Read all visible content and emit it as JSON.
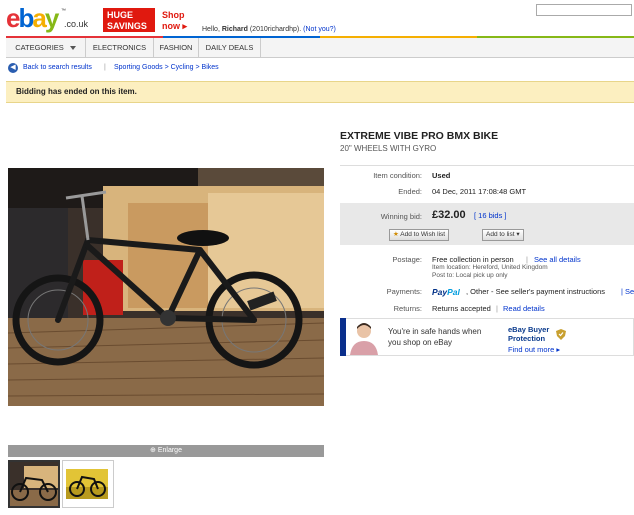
{
  "header": {
    "logo_text": "ebay.co.uk",
    "promo_badge": [
      "HUGE",
      "SAVINGS"
    ],
    "shop_now": [
      "Shop",
      "now ▸"
    ],
    "greeting_prefix": "Hello, ",
    "user_name": "Richard",
    "user_handle": " (2010richardhp).",
    "not_you": "(Not you?)"
  },
  "nav": {
    "categories": "CATEGORIES",
    "electronics": "ELECTRONICS",
    "fashion": "FASHION",
    "daily_deals": "DAILY DEALS"
  },
  "breadcrumb": {
    "back": "Back to search results",
    "sep": "|",
    "trail": "Sporting Goods > Cycling > Bikes"
  },
  "banner": "Bidding has ended on this item.",
  "gallery": {
    "enlarge": "Enlarge"
  },
  "item": {
    "title": "EXTREME VIBE PRO BMX BIKE",
    "subtitle": "20\" WHEELS WITH GYRO",
    "condition_label": "Item condition:",
    "condition_value": "Used",
    "ended_label": "Ended:",
    "ended_value": "04 Dec, 2011 17:08:48 GMT",
    "winning_bid_label": "Winning bid:",
    "winning_bid_value": "£32.00",
    "bids": "[ 16 bids ]",
    "wishlist_btn": "Add to Wish list",
    "addlist_btn": "Add to list",
    "postage_label": "Postage:",
    "postage_value": "Free collection in person",
    "see_all": "See all details",
    "location": "Item location: Hereford, United Kingdom",
    "post_to": "Post to: Local pick up only",
    "payments_label": "Payments:",
    "paypal": "PayPal",
    "payments_other": ", Other - See seller's payment instructions",
    "payments_more": "| Se",
    "returns_label": "Returns:",
    "returns_value": "Returns accepted",
    "read_details": "Read details"
  },
  "promo": {
    "line1": "You're in safe hands when",
    "line2": "you shop on eBay",
    "heading1": "eBay Buyer",
    "heading2": "Protection",
    "link": "Find out more ▸"
  },
  "colors": {
    "ebay_red": "#e53238",
    "ebay_blue": "#0064d2",
    "ebay_yellow": "#f5af02",
    "ebay_green": "#86b817",
    "banner_bg": "#fcefc0",
    "link": "#0033cc"
  }
}
